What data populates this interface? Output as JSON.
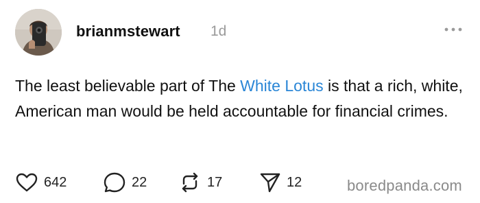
{
  "post": {
    "username": "brianmstewart",
    "timestamp": "1d",
    "text_before": "The least believable part of The ",
    "text_link": "White Lotus",
    "text_after": " is that a rich, white, American man would be held accountable for financial crimes.",
    "more_icon": "more-horizontal-icon",
    "link_color": "#2a86d6"
  },
  "actions": {
    "likes": {
      "icon": "heart-icon",
      "count": "642"
    },
    "replies": {
      "icon": "comment-icon",
      "count": "22"
    },
    "reposts": {
      "icon": "repost-icon",
      "count": "17"
    },
    "shares": {
      "icon": "send-icon",
      "count": "12"
    }
  },
  "watermark": "boredpanda.com"
}
